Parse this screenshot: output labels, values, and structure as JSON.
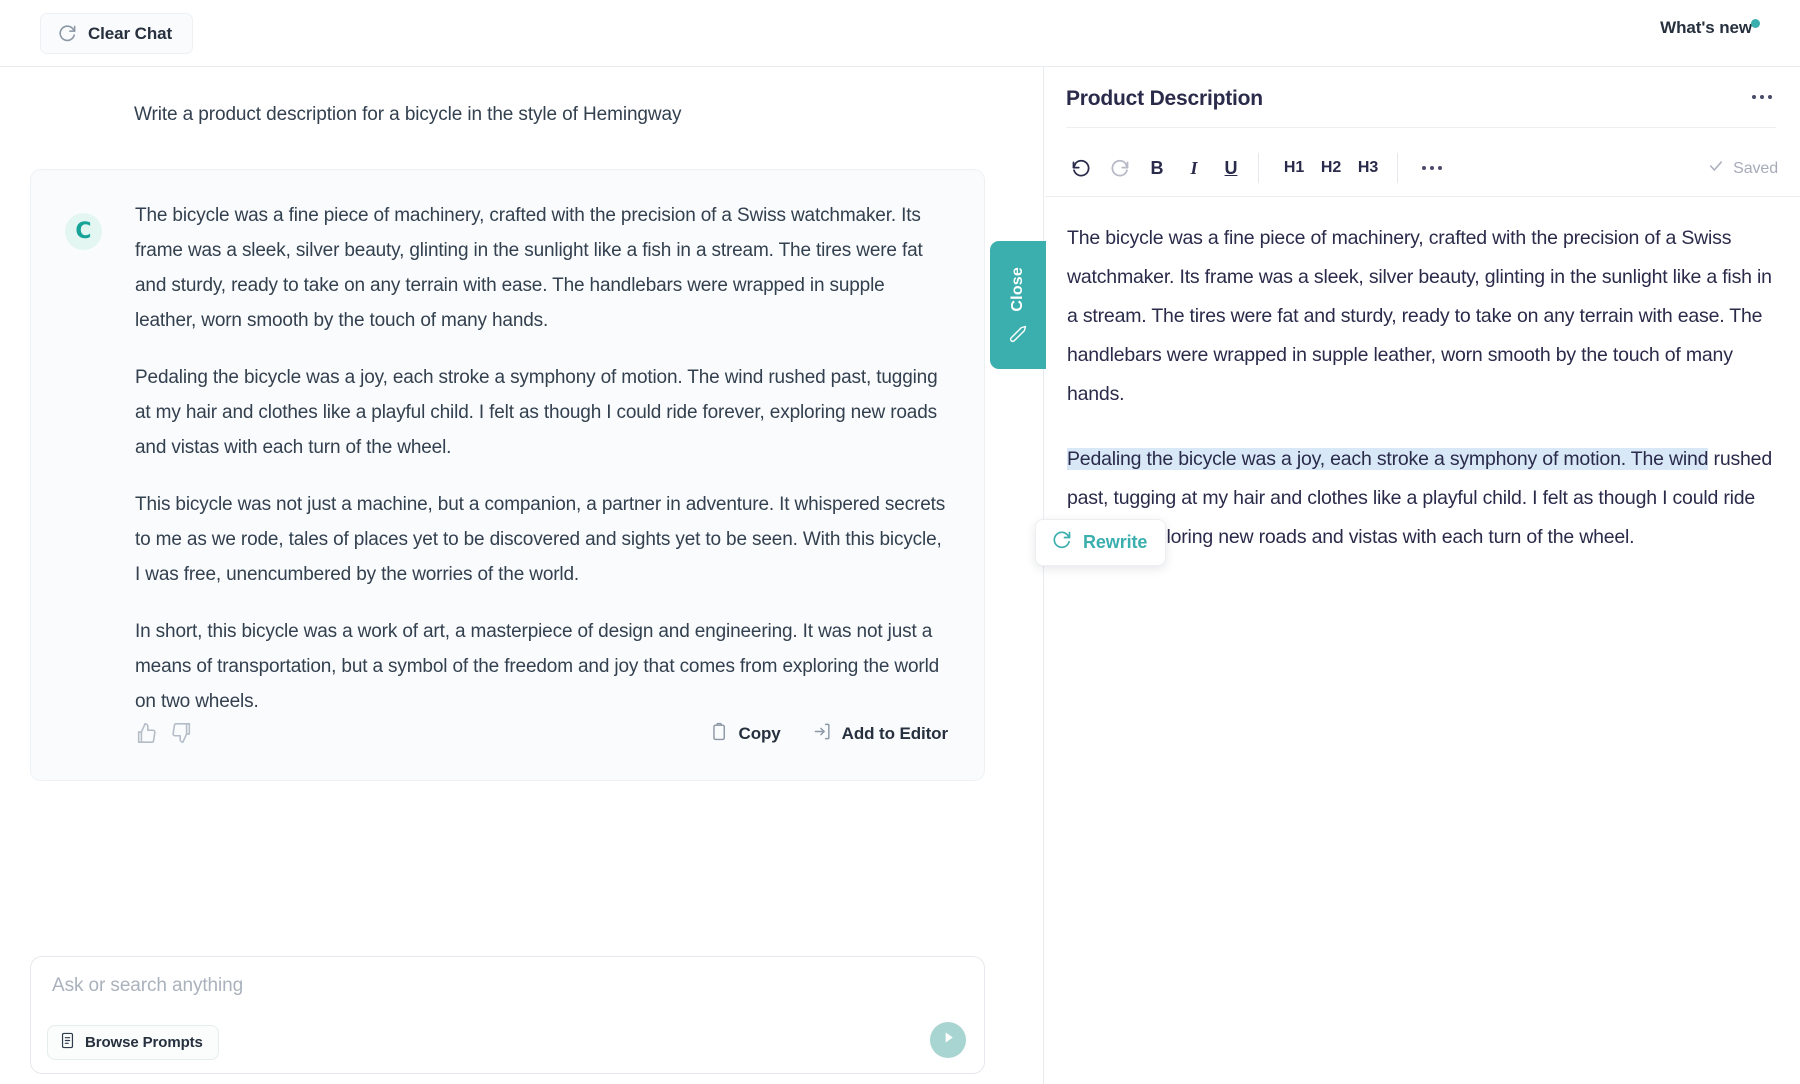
{
  "topbar": {
    "clear_chat_label": "Clear Chat",
    "clear_chat_icon": "refresh-icon",
    "whats_new_label": "What's new",
    "whats_new_badge_color": "#3aafae"
  },
  "chat": {
    "user_prompt": "Write a product description for a bicycle in the style of Hemingway",
    "assistant": {
      "avatar_letter": "C",
      "avatar_bg": "#e3f6f2",
      "avatar_fg": "#17a398",
      "paragraphs": [
        "The bicycle was a fine piece of machinery, crafted with the precision of a Swiss watchmaker. Its frame was a sleek, silver beauty, glinting in the sunlight like a fish in a stream. The tires were fat and sturdy, ready to take on any terrain with ease. The handlebars were wrapped in supple leather, worn smooth by the touch of many hands.",
        "Pedaling the bicycle was a joy, each stroke a symphony of motion. The wind rushed past, tugging at my hair and clothes like a playful child. I felt as though I could ride forever, exploring new roads and vistas with each turn of the wheel.",
        "This bicycle was not just a machine, but a companion, a partner in adventure. It whispered secrets to me as we rode, tales of places yet to be discovered and sights yet to be seen. With this bicycle, I was free, unencumbered by the worries of the world.",
        "In short, this bicycle was a work of art, a masterpiece of design and engineering. It was not just a means of transportation, but a symbol of the freedom and joy that comes from exploring the world on two wheels."
      ],
      "actions": {
        "thumbs_up_icon": "thumbs-up-icon",
        "thumbs_down_icon": "thumbs-down-icon",
        "copy_label": "Copy",
        "copy_icon": "clipboard-icon",
        "add_to_editor_label": "Add to Editor",
        "add_to_editor_icon": "add-to-editor-icon"
      }
    }
  },
  "composer": {
    "placeholder": "Ask or search anything",
    "value": "",
    "browse_prompts_label": "Browse Prompts",
    "browse_prompts_icon": "list-document-icon",
    "send_icon": "send-arrow-icon",
    "send_bg": "#a8d5d1"
  },
  "close_tab": {
    "label": "Close",
    "icon": "pen-edit-icon",
    "bg": "#3aafae"
  },
  "editor": {
    "title": "Product Description",
    "more_icon": "ellipsis-icon",
    "toolbar": {
      "undo_icon": "undo-icon",
      "redo_icon": "redo-icon",
      "bold_label": "B",
      "italic_label": "I",
      "underline_label": "U",
      "h1_label": "H1",
      "h2_label": "H2",
      "h3_label": "H3",
      "more_icon": "ellipsis-icon",
      "saved_label": "Saved",
      "saved_icon": "check-icon"
    },
    "paragraph_1": "The bicycle was a fine piece of machinery, crafted with the precision of a Swiss watchmaker. Its frame was a sleek, silver beauty, glinting in the sunlight like a fish in a stream. The tires were fat and sturdy, ready to take on any terrain with ease. The handlebars were wrapped in supple leather, worn smooth by the touch of many hands.",
    "paragraph_2_selected": "Pedaling the bicycle was a joy, each stroke a symphony of motion. The wind",
    "paragraph_2_rest": " rushed past, tugging at my hair and clothes like a playful child. I felt as though I could ride forever, exploring new roads and vistas with each turn of the wheel.",
    "selection_highlight_color": "#d8e8f7"
  },
  "rewrite_popup": {
    "label": "Rewrite",
    "icon": "refresh-icon",
    "color": "#3aafae"
  }
}
